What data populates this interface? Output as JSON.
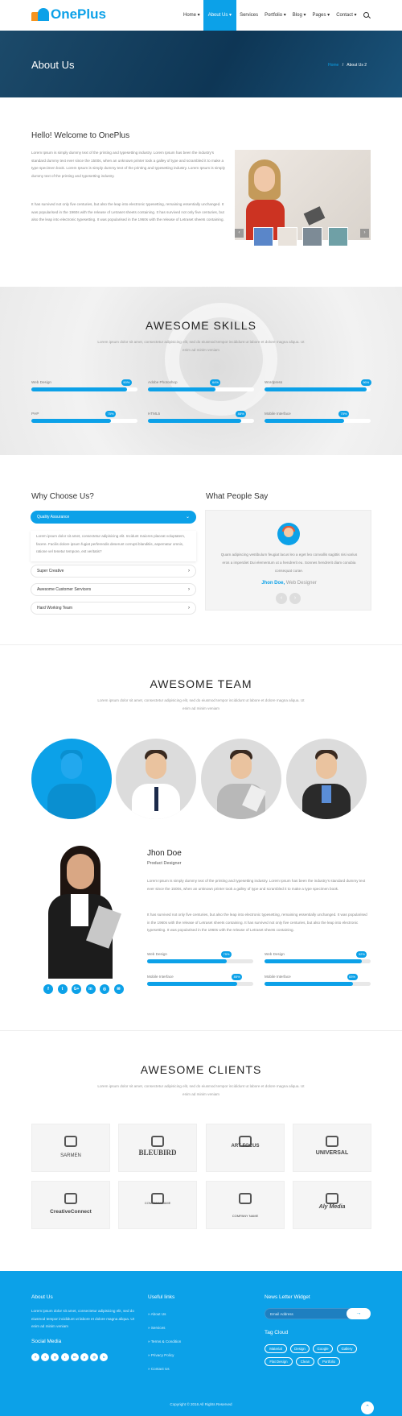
{
  "header": {
    "logo": "OnePlus",
    "nav": [
      "Home",
      "About Us",
      "Services",
      "Portfolio",
      "Blog",
      "Pages",
      "Contact"
    ],
    "nav_dropdown": [
      true,
      true,
      false,
      true,
      true,
      true,
      true
    ],
    "active_index": 1
  },
  "banner": {
    "title": "About Us",
    "crumb_home": "Home",
    "crumb_sep": "/",
    "crumb_current": "About Us 2"
  },
  "welcome": {
    "title": "Hello! Welcome to OnePlus",
    "p1": "Lorem Ipsum is simply dummy text of the printing and typesetting industry. Lorem Ipsum has been the industry's standard dummy text ever since the 1500s, when an unknown printer took a galley of type and scrambled it to make a type specimen book. Lorem Ipsum is simply dummy text of the printing and typesetting industry. Lorem Ipsum is simply dummy text of the printing and typesetting industry.",
    "p2": "It has survived not only five centuries, but also the leap into electronic typesetting, remaining essentially unchanged. It was popularised in the 1960s with the release of Letraset sheets containing. It has survived not only five centuries, but also the leap into electronic typesetting. It was popularised in the 1960s with the release of Letraset sheets containing.",
    "gallery_prev": "‹",
    "gallery_next": "›"
  },
  "skills": {
    "title": "AWESOME SKILLS",
    "subtitle": "Lorem ipsum dolor sit amet, consectetur adipisicing elit, sed do eiusmod tempor incididunt ut labore et dolore magna aliqua. Ut enim ad minim veniam",
    "items": [
      {
        "label": "Web Design",
        "value": 90
      },
      {
        "label": "Adobe Photoshop",
        "value": 64
      },
      {
        "label": "Wordpress",
        "value": 96
      },
      {
        "label": "PHP",
        "value": 75
      },
      {
        "label": "HTML5",
        "value": 88
      },
      {
        "label": "Mobile Interface",
        "value": 75
      }
    ]
  },
  "why": {
    "title": "Why Choose Us?",
    "items": [
      "Quality Assurance",
      "Super Creative",
      "Awesome Customer Servicers",
      "Hard Working Team"
    ],
    "open_body": "Lorem ipsum dolor sit amet, consectetur adipisicing elit. Incidunt maiores placeat voluptatem, facere. Facilis dolore ipsum fugiat perferendis deserunt corrupti blanditiis, aspernatur omnis, ratione vel tenetur tempore, est veritatis?"
  },
  "testimonial": {
    "title": "What People Say",
    "quote": "Quam adipiscing vestibulum feugiat lacus leo a eget leo convallis sagittis nisi varius eros a imperdiet Dui elementum ut a hendrerit eu. Sonnes hendrerit diam conubia consequat curae.",
    "name": "Jhon Doe,",
    "role": "Web Designer",
    "prev": "‹",
    "next": "›"
  },
  "team": {
    "title": "AWESOME TEAM",
    "subtitle": "Lorem ipsum dolor sit amet, consectetur adipisicing elit, sed do eiusmod tempor incididunt ut labore et dolore magna aliqua. Ut enim ad minim veniam",
    "member": {
      "name": "Jhon Doe",
      "role": "Product Designer",
      "p1": "Lorem Ipsum is simply dummy text of the printing and typesetting industry. Lorem Ipsum has been the industry's standard dummy text ever since the 1500s, when an unknown printer took a galley of type and scrambled it to make a type specimen book.",
      "p2": "It has survived not only five centuries, but also the leap into electronic typesetting, remaining essentially unchanged. It was popularised in the 1960s with the release of Letraset sheets containing. It has survived not only five centuries, but also the leap into electronic typesetting. It was popularised in the 1960s with the release of Letraset sheets containing.",
      "skills": [
        {
          "label": "Web Design",
          "value": 75
        },
        {
          "label": "Web Design",
          "value": 92
        },
        {
          "label": "Mobile Interface",
          "value": 85
        },
        {
          "label": "Mobile Interface",
          "value": 83
        }
      ],
      "social": [
        "f",
        "t",
        "G+",
        "in",
        "◎",
        "✉"
      ]
    }
  },
  "clients": {
    "title": "AWESOME CLIENTS",
    "subtitle": "Lorem ipsum dolor sit amet, consectetur adipisicing elit, sed do eiusmod tempor incididunt ut labore et dolore magna aliqua. Ut enim ad minim veniam",
    "logos": [
      "SARMEN",
      "BLEUBIRD",
      "ART FOCUS",
      "UNIVERSAL",
      "CreativeConnect",
      "COMPANY NAME",
      "COMPANY NAME",
      "Aly Media"
    ]
  },
  "footer": {
    "about_title": "About Us",
    "about_text": "Lorem ipsum dolor sit amet, consectetur adipisicing elit, sed do eiusmod tempor incididunt ut labore et dolore magna aliqua. Ut enim ad minim veniam",
    "social_title": "Social Media",
    "social": [
      "f",
      "t",
      "g",
      "t",
      "in",
      "p",
      "◎",
      "b"
    ],
    "links_title": "Useful links",
    "links": [
      "» About Us",
      "» Services",
      "» Terms & Condition",
      "» Privacy Policy",
      "» Contact Us"
    ],
    "news_title": "News Letter Widget",
    "email_placeholder": "Email Address",
    "send": "→",
    "tags_title": "Tag Cloud",
    "tags": [
      "Material",
      "Design",
      "Google",
      "Gallery",
      "Flat Design",
      "Clean",
      "Portfolio"
    ],
    "copyright": "Copyright © 2016 All Rights Reserved",
    "to_top": "⌃"
  },
  "colors": {
    "accent": "#0ca1e8",
    "banner": "#0e3655"
  }
}
